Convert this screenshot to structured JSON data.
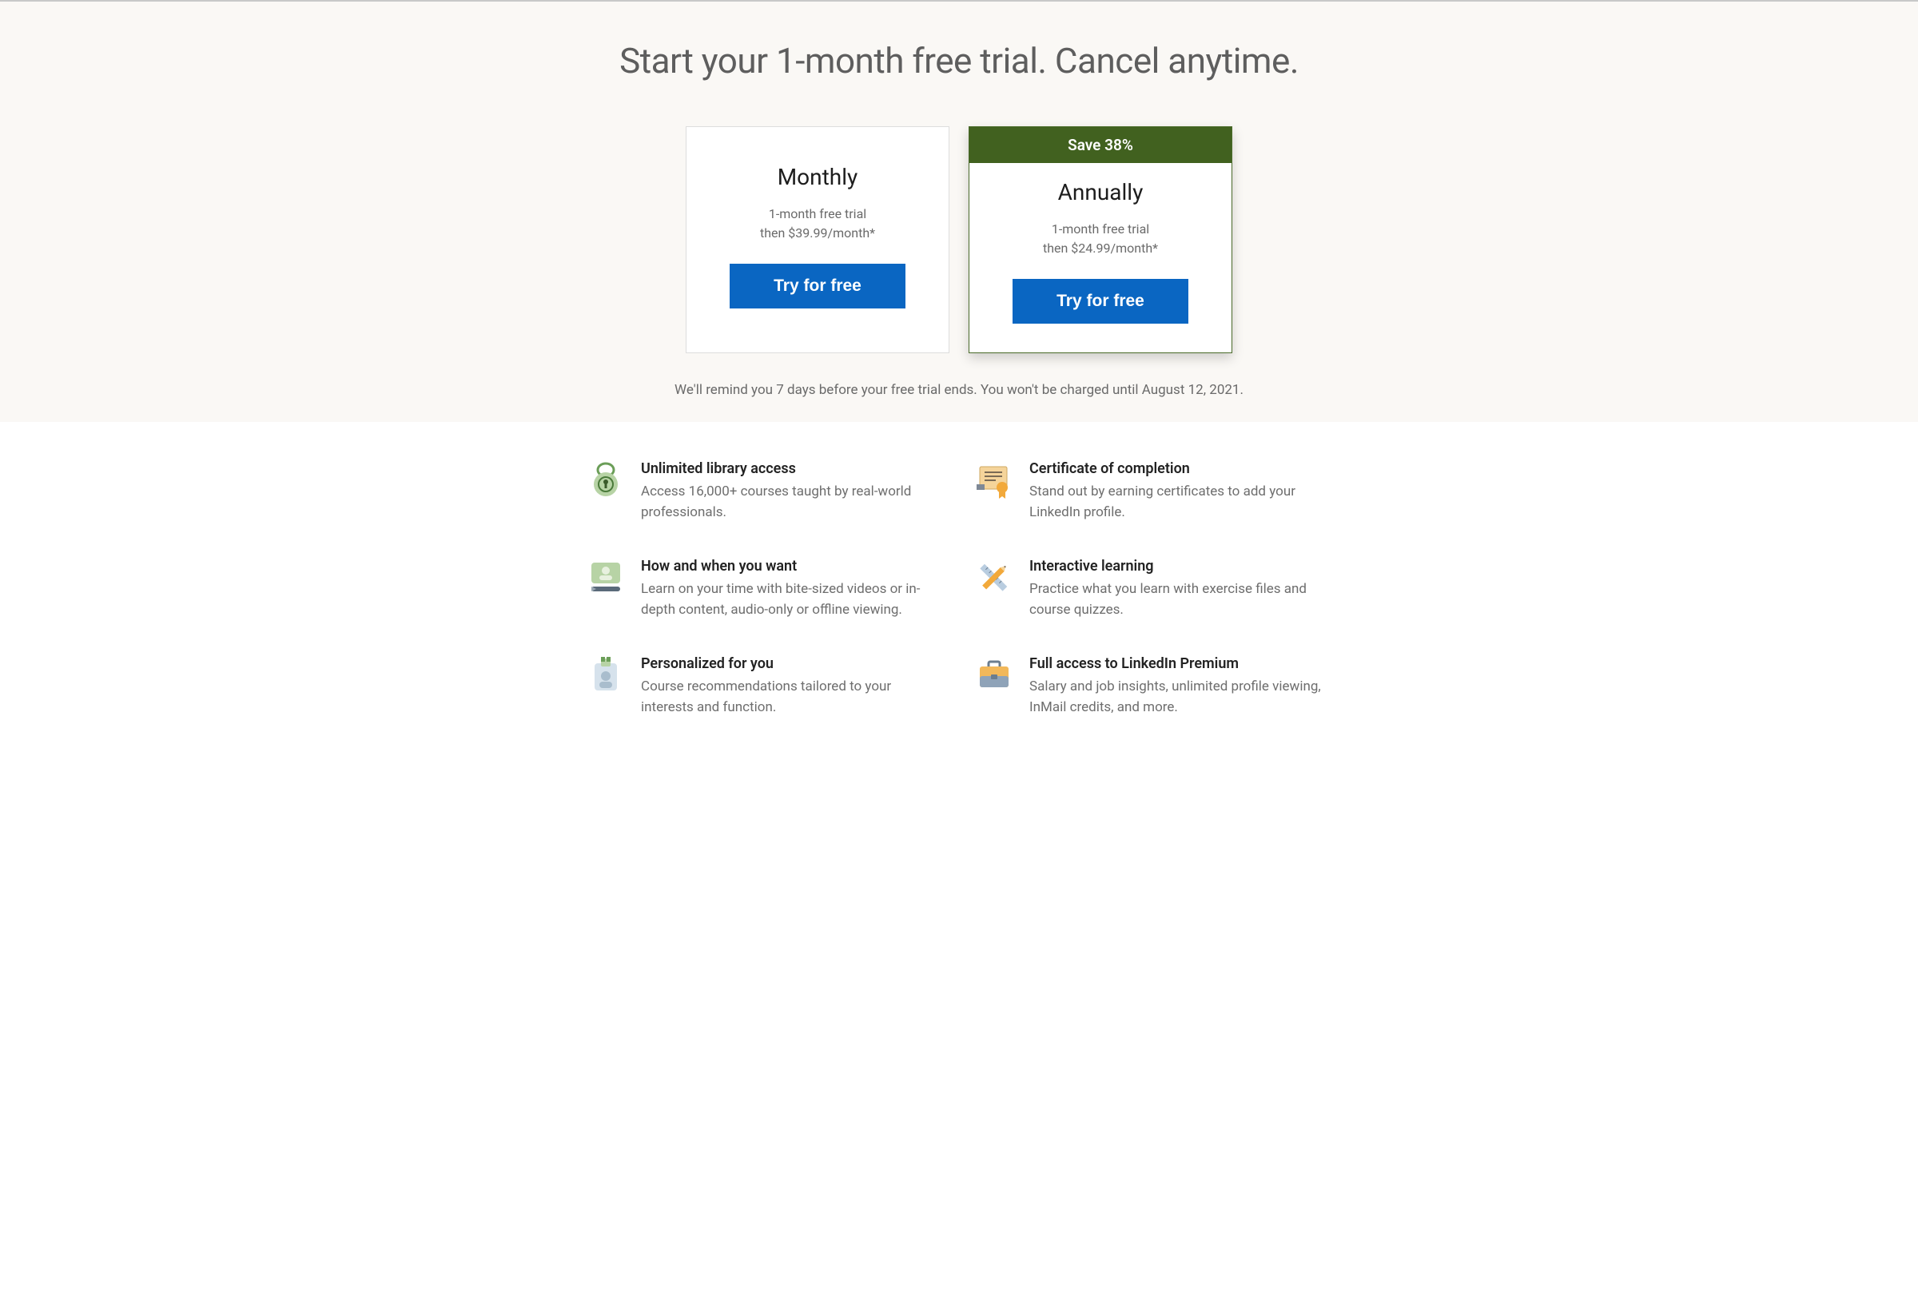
{
  "headline": "Start your 1-month free trial. Cancel anytime.",
  "plans": {
    "monthly": {
      "name": "Monthly",
      "sub1": "1-month free trial",
      "sub2": "then $39.99/month*",
      "cta": "Try for free"
    },
    "annually": {
      "banner": "Save 38%",
      "name": "Annually",
      "sub1": "1-month free trial",
      "sub2": "then $24.99/month*",
      "cta": "Try for free"
    }
  },
  "reminder": "We'll remind you 7 days before your free trial ends. You won't be charged until August 12, 2021.",
  "features": [
    {
      "title": "Unlimited library access",
      "desc": "Access 16,000+ courses taught by real-world professionals."
    },
    {
      "title": "Certificate of completion",
      "desc": "Stand out by earning certificates to add your LinkedIn profile."
    },
    {
      "title": "How and when you want",
      "desc": "Learn on your time with bite-sized videos or in-depth content, audio-only or offline viewing."
    },
    {
      "title": "Interactive learning",
      "desc": "Practice what you learn with exercise files and course quizzes."
    },
    {
      "title": "Personalized for you",
      "desc": "Course recommendations tailored to your interests and function."
    },
    {
      "title": "Full access to LinkedIn Premium",
      "desc": "Salary and job insights, unlimited profile viewing, InMail credits, and more."
    }
  ]
}
